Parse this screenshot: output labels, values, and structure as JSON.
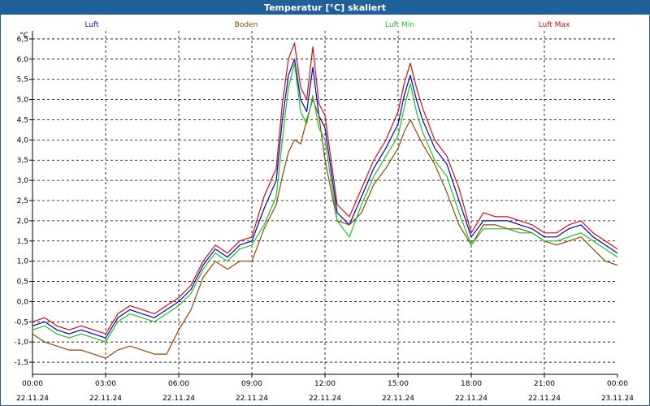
{
  "window": {
    "title": "Temperatur [°C] skaliert"
  },
  "chart_data": {
    "type": "line",
    "title": "Temperatur [°C] skaliert",
    "ylabel": "°C",
    "xlabel": "",
    "ylim": [
      -1.8,
      6.7
    ],
    "grid": true,
    "legend_position": "top",
    "y_ticks": [
      "6,5",
      "6,0",
      "5,5",
      "5,0",
      "4,5",
      "4,0",
      "3,5",
      "3,0",
      "2,5",
      "2,0",
      "1,5",
      "1,0",
      "0,5",
      "0,0",
      "-0,5",
      "-1,0",
      "-1,5"
    ],
    "x_ticks": [
      {
        "time": "00:00",
        "date": "22.11.24"
      },
      {
        "time": "03:00",
        "date": "22.11.24"
      },
      {
        "time": "06:00",
        "date": "22.11.24"
      },
      {
        "time": "09:00",
        "date": "22.11.24"
      },
      {
        "time": "12:00",
        "date": "22.11.24"
      },
      {
        "time": "15:00",
        "date": "22.11.24"
      },
      {
        "time": "18:00",
        "date": "22.11.24"
      },
      {
        "time": "21:00",
        "date": "22.11.24"
      },
      {
        "time": "00:00",
        "date": "23.11.24"
      }
    ],
    "x_hours": [
      0,
      0.5,
      1,
      1.5,
      2,
      2.5,
      3,
      3.5,
      4,
      4.5,
      5,
      5.5,
      6,
      6.5,
      7,
      7.5,
      8,
      8.5,
      9,
      9.5,
      10,
      10.25,
      10.5,
      10.75,
      11,
      11.25,
      11.5,
      11.75,
      12,
      12.5,
      13,
      13.5,
      14,
      14.5,
      15,
      15.25,
      15.5,
      15.75,
      16,
      16.5,
      17,
      17.5,
      18,
      18.5,
      19,
      19.5,
      20,
      20.5,
      21,
      21.5,
      22,
      22.5,
      23,
      23.5,
      24
    ],
    "series": [
      {
        "name": "Luft",
        "color": "#0000c8",
        "values": [
          -0.6,
          -0.5,
          -0.7,
          -0.8,
          -0.7,
          -0.8,
          -0.9,
          -0.4,
          -0.2,
          -0.3,
          -0.4,
          -0.2,
          0.0,
          0.3,
          0.9,
          1.3,
          1.1,
          1.4,
          1.5,
          2.3,
          3.0,
          4.5,
          5.6,
          6.0,
          5.0,
          4.7,
          5.8,
          4.6,
          4.3,
          2.2,
          1.9,
          2.6,
          3.3,
          3.8,
          4.4,
          5.1,
          5.6,
          5.0,
          4.5,
          3.8,
          3.4,
          2.5,
          1.6,
          2.0,
          2.0,
          2.0,
          1.9,
          1.8,
          1.6,
          1.6,
          1.8,
          1.9,
          1.6,
          1.4,
          1.2
        ]
      },
      {
        "name": "Boden",
        "color": "#8b4a00",
        "values": [
          -0.8,
          -1.0,
          -1.1,
          -1.2,
          -1.2,
          -1.3,
          -1.4,
          -1.2,
          -1.1,
          -1.2,
          -1.3,
          -1.3,
          -0.7,
          -0.2,
          0.6,
          1.0,
          0.8,
          1.0,
          1.0,
          1.8,
          2.4,
          3.1,
          3.7,
          4.0,
          3.9,
          4.5,
          5.0,
          4.6,
          3.5,
          2.0,
          1.9,
          2.2,
          2.9,
          3.3,
          3.8,
          4.2,
          4.5,
          4.2,
          3.9,
          3.4,
          2.7,
          1.9,
          1.4,
          1.9,
          1.9,
          1.8,
          1.8,
          1.7,
          1.5,
          1.4,
          1.5,
          1.6,
          1.3,
          1.0,
          0.9
        ]
      },
      {
        "name": "Luft Min",
        "color": "#20c020",
        "values": [
          -0.7,
          -0.6,
          -0.8,
          -0.9,
          -0.8,
          -0.9,
          -1.0,
          -0.5,
          -0.3,
          -0.4,
          -0.5,
          -0.3,
          -0.1,
          0.2,
          0.8,
          1.2,
          1.0,
          1.3,
          1.4,
          1.9,
          2.6,
          4.0,
          5.3,
          5.9,
          4.7,
          4.4,
          5.1,
          4.3,
          4.0,
          2.0,
          1.6,
          2.4,
          3.1,
          3.6,
          4.1,
          4.8,
          5.4,
          4.7,
          4.2,
          3.5,
          3.1,
          2.2,
          1.4,
          1.8,
          1.8,
          1.8,
          1.7,
          1.7,
          1.5,
          1.5,
          1.6,
          1.7,
          1.5,
          1.3,
          1.1
        ]
      },
      {
        "name": "Luft Max",
        "color": "#d01010",
        "values": [
          -0.5,
          -0.4,
          -0.6,
          -0.7,
          -0.6,
          -0.7,
          -0.8,
          -0.3,
          -0.1,
          -0.2,
          -0.3,
          -0.1,
          0.1,
          0.4,
          1.0,
          1.4,
          1.2,
          1.5,
          1.6,
          2.6,
          3.3,
          4.9,
          6.0,
          6.4,
          5.3,
          5.0,
          6.3,
          4.9,
          4.6,
          2.4,
          2.1,
          2.8,
          3.5,
          4.0,
          4.7,
          5.4,
          5.9,
          5.3,
          4.8,
          4.0,
          3.6,
          2.8,
          1.7,
          2.2,
          2.1,
          2.1,
          2.0,
          1.9,
          1.7,
          1.7,
          1.9,
          2.0,
          1.7,
          1.5,
          1.3
        ]
      }
    ]
  }
}
